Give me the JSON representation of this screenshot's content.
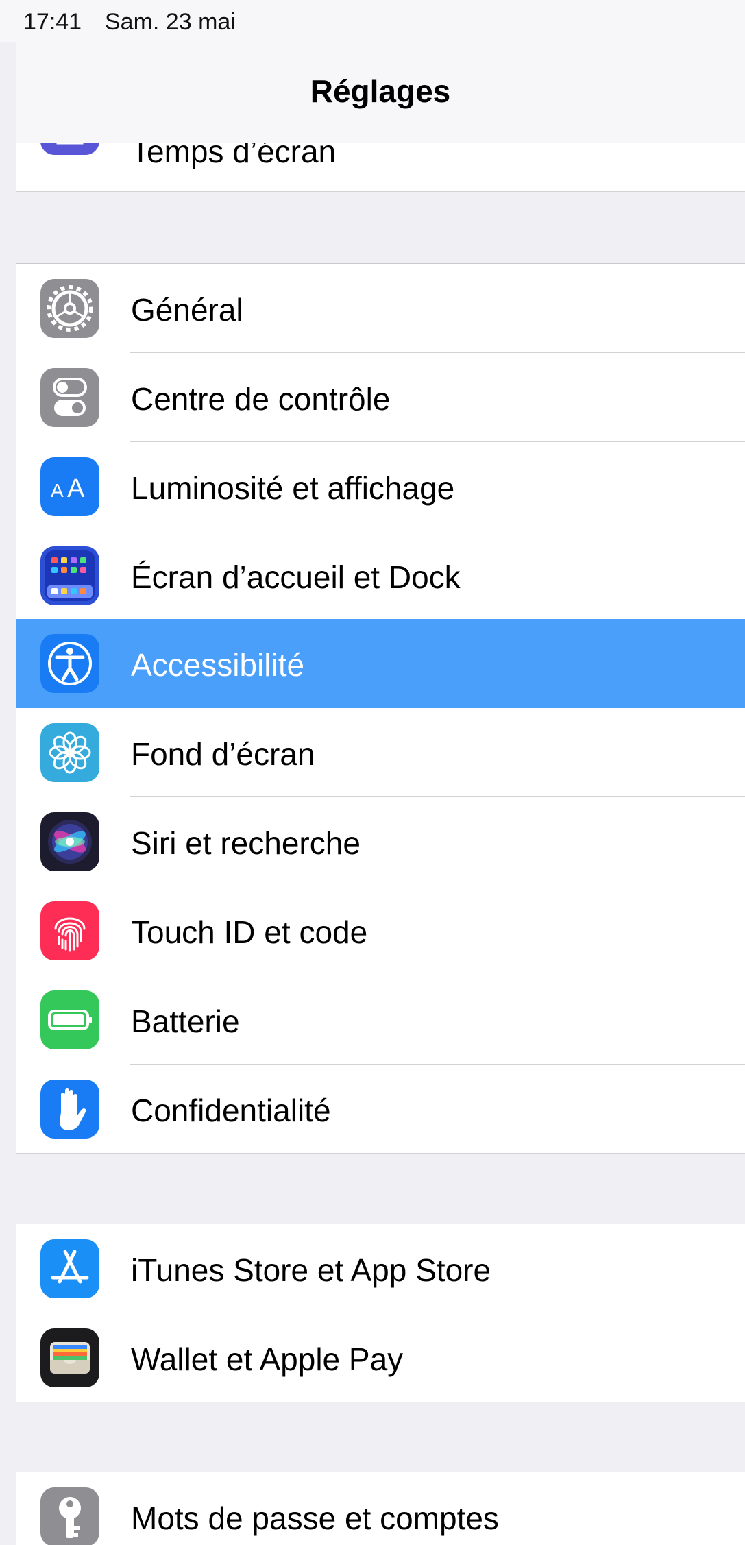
{
  "status_bar": {
    "time": "17:41",
    "date": "Sam. 23 mai"
  },
  "nav": {
    "title": "Réglages"
  },
  "rows": [
    {
      "label": "Temps d’écran",
      "icon": "hourglass-icon",
      "color": "#5856d6"
    },
    {
      "label": "Général",
      "icon": "gear-icon",
      "color": "#8e8e93"
    },
    {
      "label": "Centre de contrôle",
      "icon": "toggles-icon",
      "color": "#8e8e93"
    },
    {
      "label": "Luminosité et affichage",
      "icon": "text-size-icon",
      "color": "#1a7cf5"
    },
    {
      "label": "Écran d’accueil et Dock",
      "icon": "home-grid-icon",
      "color": "#2d4fd6"
    },
    {
      "label": "Accessibilité",
      "icon": "accessibility-icon",
      "color": "#1a7cf5",
      "selected": true
    },
    {
      "label": "Fond d’écran",
      "icon": "flower-icon",
      "color": "#35aadc"
    },
    {
      "label": "Siri et recherche",
      "icon": "siri-icon",
      "color": "#1c1c2e"
    },
    {
      "label": "Touch ID et code",
      "icon": "fingerprint-icon",
      "color": "#fe2d55"
    },
    {
      "label": "Batterie",
      "icon": "battery-icon",
      "color": "#34c759"
    },
    {
      "label": "Confidentialité",
      "icon": "hand-icon",
      "color": "#1a7cf5"
    },
    {
      "label": "iTunes Store et App Store",
      "icon": "app-store-icon",
      "color": "#1a8ff5"
    },
    {
      "label": "Wallet et Apple Pay",
      "icon": "wallet-icon",
      "color": "#1c1c1e"
    },
    {
      "label": "Mots de passe et comptes",
      "icon": "key-icon",
      "color": "#8e8e93"
    }
  ],
  "colors": {
    "selection": "#4a9ffb",
    "group_background": "#efeff4",
    "separator": "#d1d1d6"
  }
}
